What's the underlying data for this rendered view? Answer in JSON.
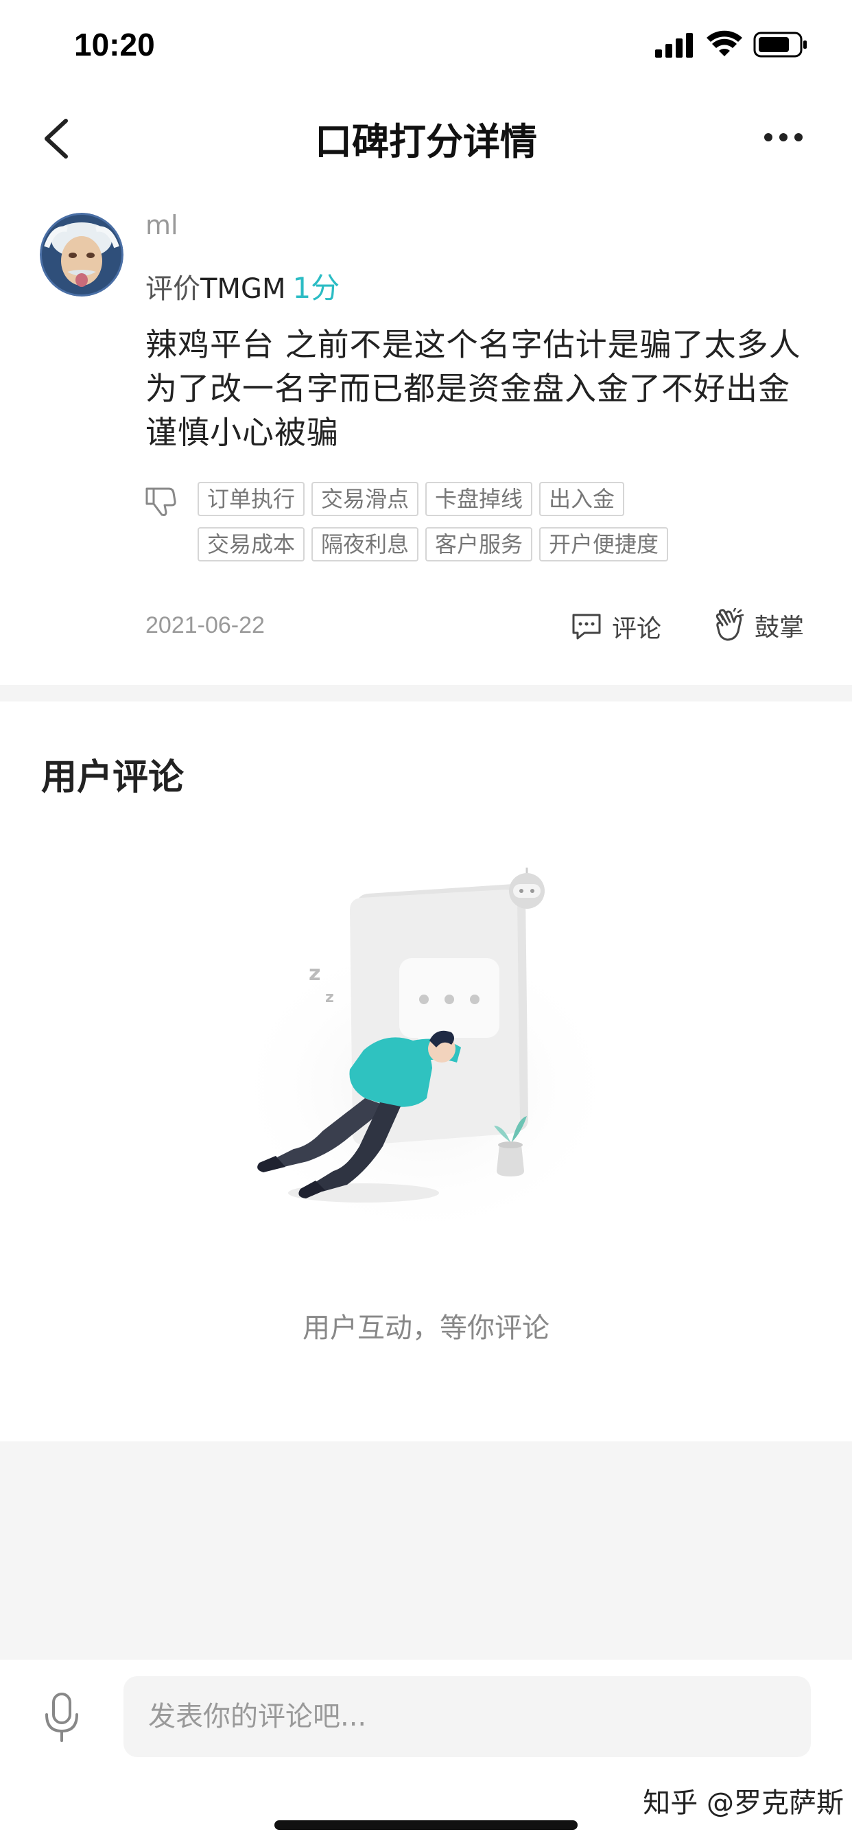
{
  "status_bar": {
    "time": "10:20"
  },
  "nav": {
    "title": "口碑打分详情"
  },
  "review": {
    "username": "ml",
    "rating_prefix": "评价",
    "broker": "TMGM",
    "score": "1分",
    "text": "辣鸡平台   之前不是这个名字估计是骗了太多人为了改一名字而已都是资金盘入金了不好出金谨慎小心被骗",
    "tags": [
      "订单执行",
      "交易滑点",
      "卡盘掉线",
      "出入金",
      "交易成本",
      "隔夜利息",
      "客户服务",
      "开户便捷度"
    ],
    "date": "2021-06-22",
    "comment_label": "评论",
    "clap_label": "鼓掌"
  },
  "comments_section": {
    "title": "用户评论",
    "empty_text": "用户互动，等你评论"
  },
  "bottom": {
    "input_placeholder": "发表你的评论吧...",
    "watermark": "知乎 @罗克萨斯"
  }
}
